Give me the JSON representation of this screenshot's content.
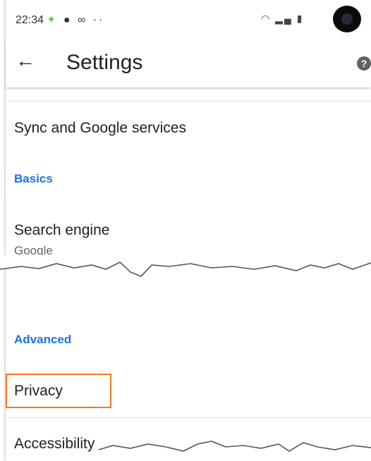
{
  "status_bar": {
    "time": "22:34",
    "left_icons": [
      "android-icon",
      "notification-icon",
      "voicemail-icon",
      "more-dots-icon"
    ],
    "more_dots": "··",
    "right_icons": [
      "wifi-icon",
      "signal-icon",
      "battery-icon"
    ]
  },
  "app_bar": {
    "back_glyph": "←",
    "title": "Settings",
    "help_glyph": "?"
  },
  "items": {
    "sync": "Sync and Google services",
    "basics_header": "Basics",
    "search_engine": "Search engine",
    "search_engine_value": "Google",
    "advanced_header": "Advanced",
    "privacy": "Privacy",
    "accessibility": "Accessibility"
  },
  "colors": {
    "section_header": "#1a73e8",
    "highlight_box": "#f07a22"
  }
}
